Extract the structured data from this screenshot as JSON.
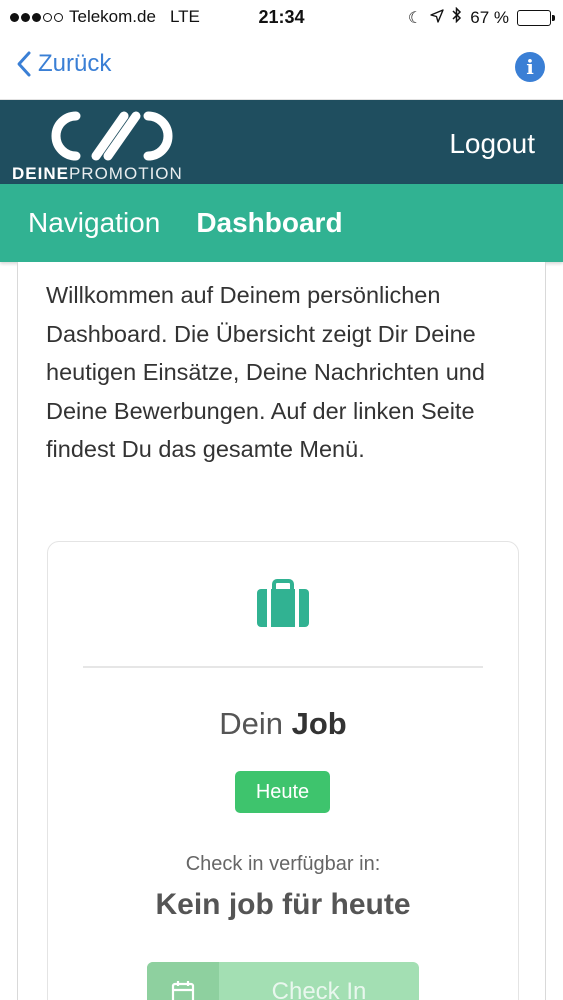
{
  "status_bar": {
    "carrier": "Telekom.de",
    "network": "LTE",
    "time": "21:34",
    "battery_percent": "67 %",
    "battery_level": 0.67
  },
  "nav_bar": {
    "back_label": "Zurück",
    "info_label": "i"
  },
  "brand": {
    "name_bold": "DEINE",
    "name_light": "PROMOTION",
    "logout_label": "Logout"
  },
  "tabs": [
    {
      "label": "Navigation",
      "active": false
    },
    {
      "label": "Dashboard",
      "active": true
    }
  ],
  "intro_text": "Willkommen auf Deinem persönlichen Dashboard. Die Übersicht zeigt Dir Deine heutigen Einsätze, Deine Nachrichten und Deine Bewerbungen. Auf der linken Seite findest Du das gesamte Menü.",
  "job_card": {
    "title_light": "Dein",
    "title_bold": "Job",
    "badge": "Heute",
    "checkin_label": "Check in verfügbar in:",
    "checkin_value": "Kein job für heute",
    "checkin_button": "Check In",
    "icon": "briefcase-icon"
  },
  "colors": {
    "brand_dark": "#1f4e5f",
    "teal": "#31b292",
    "link_blue": "#3a7fd5",
    "badge_green": "#3ec46d"
  }
}
